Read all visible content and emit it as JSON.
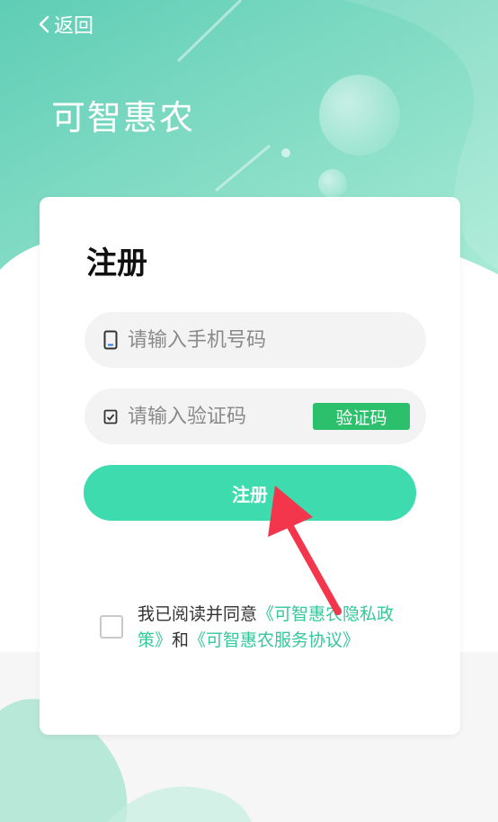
{
  "nav": {
    "back_label": "返回"
  },
  "app": {
    "title": "可智惠农"
  },
  "form": {
    "title": "注册",
    "phone": {
      "placeholder": "请输入手机号码",
      "value": ""
    },
    "code": {
      "placeholder": "请输入验证码",
      "value": "",
      "button_label": "验证码"
    },
    "submit_label": "注册"
  },
  "agreement": {
    "prefix": "我已阅读并同意",
    "privacy_link": "《可智惠农隐私政策》",
    "joiner": "和",
    "service_link": "《可智惠农服务协议》",
    "checked": false
  },
  "colors": {
    "header_gradient_start": "#5fcdb5",
    "header_gradient_end": "#a6ead4",
    "accent": "#3ddbae",
    "code_button": "#2cbf6c",
    "link": "#35c79a",
    "annotation_arrow": "#f4364c"
  },
  "icons": {
    "back": "chevron-left-icon",
    "phone": "phone-icon",
    "code": "check-square-icon",
    "annotation": "red-arrow-icon"
  }
}
